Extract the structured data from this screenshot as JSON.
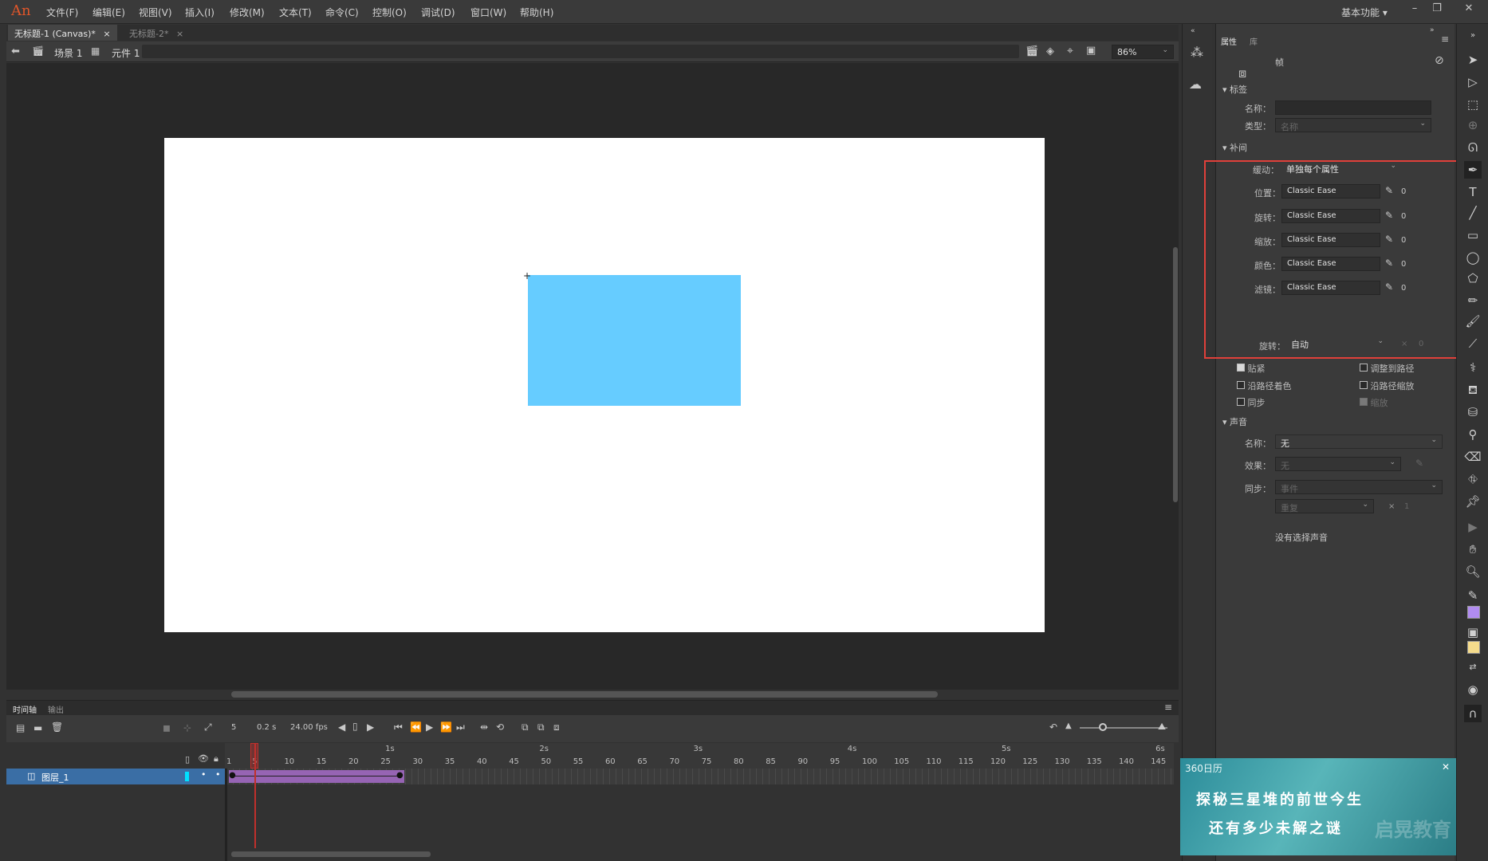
{
  "app": {
    "logo": "An",
    "workspace": "基本功能 ▾"
  },
  "menu": [
    "文件(F)",
    "编辑(E)",
    "视图(V)",
    "插入(I)",
    "修改(M)",
    "文本(T)",
    "命令(C)",
    "控制(O)",
    "调试(D)",
    "窗口(W)",
    "帮助(H)"
  ],
  "doc_tabs": [
    {
      "label": "无标题-1 (Canvas)*",
      "close": "×"
    },
    {
      "label": "无标题-2*",
      "close": "×"
    }
  ],
  "breadcrumb": {
    "scene": "场景 1",
    "symbol": "元件 1",
    "zoom": "86%"
  },
  "stage": {
    "background": "#ffffff",
    "shape_color": "#66ccff"
  },
  "timeline": {
    "tabs": [
      "时间轴",
      "输出"
    ],
    "current_frame": "5",
    "time": "0.2 s",
    "fps": "24.00 fps",
    "seconds": [
      "1s",
      "2s",
      "3s",
      "4s",
      "5s",
      "6s"
    ],
    "frame_ticks": [
      "1",
      "5",
      "10",
      "15",
      "20",
      "25",
      "30",
      "35",
      "40",
      "45",
      "50",
      "55",
      "60",
      "65",
      "70",
      "75",
      "80",
      "85",
      "90",
      "95",
      "100",
      "105",
      "110",
      "115",
      "120",
      "125",
      "130",
      "135",
      "140",
      "145"
    ],
    "layer_name": "图层_1",
    "tween_color": "#9664b4"
  },
  "props": {
    "tabs": [
      "属性",
      "库"
    ],
    "type_label": "帧",
    "label_section": {
      "title": "标签",
      "name_label": "名称：",
      "type_label": "类型：",
      "type_value": "名称"
    },
    "tween_section": {
      "title": "补间",
      "ease_label": "缓动：",
      "ease_value": "单独每个属性",
      "rows": [
        {
          "label": "位置：",
          "value": "Classic Ease",
          "amount": "0"
        },
        {
          "label": "旋转：",
          "value": "Classic Ease",
          "amount": "0"
        },
        {
          "label": "缩放：",
          "value": "Classic Ease",
          "amount": "0"
        },
        {
          "label": "颜色：",
          "value": "Classic Ease",
          "amount": "0"
        },
        {
          "label": "滤镜：",
          "value": "Classic Ease",
          "amount": "0"
        }
      ],
      "rotate_label": "旋转：",
      "rotate_value": "自动",
      "rotate_x": "×",
      "rotate_count": "0"
    },
    "checkboxes": [
      {
        "label": "贴紧",
        "checked": true
      },
      {
        "label": "调整到路径",
        "checked": false
      },
      {
        "label": "沿路径着色",
        "checked": false
      },
      {
        "label": "沿路径缩放",
        "checked": false
      },
      {
        "label": "同步",
        "checked": false
      },
      {
        "label": "缩放",
        "checked": true
      }
    ],
    "sound_section": {
      "title": "声音",
      "name_label": "名称：",
      "name_value": "无",
      "effect_label": "效果：",
      "effect_value": "无",
      "sync_label": "同步：",
      "sync_value": "事件",
      "repeat_value": "重复",
      "repeat_x": "×",
      "repeat_count": "1",
      "no_sound": "没有选择声音"
    }
  },
  "ad": {
    "brand": "360日历",
    "line1": "探秘三星堆的前世今生",
    "line2": "还有多少未解之谜",
    "watermark": "启晃教育",
    "close": "✕"
  },
  "colors": {
    "fill": "#b18cf0",
    "stroke": "#f5dc8c",
    "highlight": "#e0403a"
  }
}
